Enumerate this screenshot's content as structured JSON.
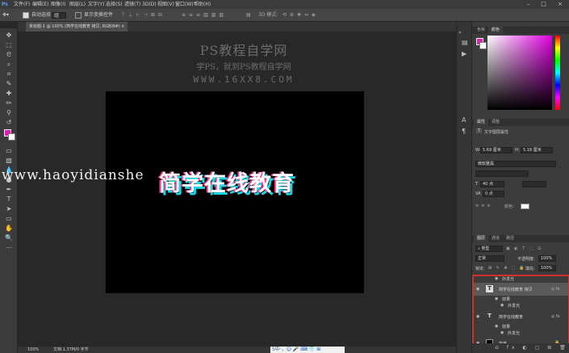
{
  "menubar": {
    "items": [
      "文件(F)",
      "编辑(E)",
      "图像(I)",
      "图层(L)",
      "文字(Y)",
      "选择(S)",
      "滤镜(T)",
      "3D(D)",
      "视图(V)",
      "窗口(W)",
      "帮助(H)"
    ],
    "window_controls": "– □ ×"
  },
  "options_bar": {
    "auto_select_label": "自动选择：",
    "auto_select_value": "组",
    "show_transform_label": "显示变换控件"
  },
  "document": {
    "tab_title": "未标题-1 @ 100% (简学在线教育 拷贝, RGB/8#)",
    "watermark_title": "PS教程自学网",
    "watermark_subtitle": "学PS，就到PS教程自学网",
    "watermark_url": "WWW.16XX8.COM",
    "site_watermark": "www.haoyidianshe",
    "hero_text": "简学在线教育"
  },
  "statusbar": {
    "zoom": "100%",
    "doc_info": "文档:1.37M/0 字节",
    "ime": "S中·，☺ 🎤 ⌨ 👕 ⊞"
  },
  "color_panel": {
    "tab_swatches": "色板",
    "tab_color": "颜色",
    "fg_color": "#e21ab4",
    "bg_color": "#ffffff"
  },
  "properties_panel": {
    "tab_properties": "属性",
    "tab_adjust": "调整",
    "header": "文字图层属性",
    "w_value": "5.69 厘米",
    "h_value": "5.18 厘米",
    "font_family": "微软雅黑",
    "font_size": "40 点",
    "leading": "0 点"
  },
  "layers_panel": {
    "tab_layers": "图层",
    "tab_channels": "通道",
    "tab_paths": "路径",
    "kind": "类型",
    "blend_mode": "正常",
    "opacity_label": "不透明度:",
    "opacity_value": "100%",
    "lock_label": "锁定:",
    "fill_label": "填充:",
    "fill_value": "100%",
    "layers": [
      {
        "name": "外发光"
      },
      {
        "name": "简学在线教育 拷贝",
        "type_icon": "T"
      },
      {
        "name": "效果"
      },
      {
        "name": "外发光"
      },
      {
        "name": "简学在线教育",
        "type_icon": "T"
      },
      {
        "name": "效果"
      },
      {
        "name": "外发光"
      },
      {
        "name": "背景"
      }
    ],
    "footer_icons": "⊖ fx ◐ ▢ ⊞ 🗑"
  }
}
